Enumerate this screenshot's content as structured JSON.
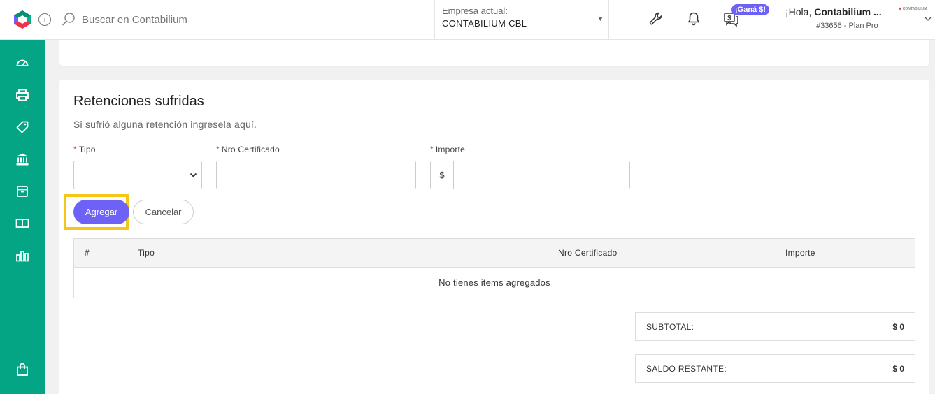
{
  "header": {
    "search_placeholder": "Buscar en Contabilium",
    "company_label": "Empresa actual:",
    "company_name": "CONTABILIUM CBL",
    "promo_badge": "¡Ganá $!",
    "greeting_prefix": "¡Hola, ",
    "greeting_name": "Contabilium ...",
    "plan": "#33656 - Plan Pro",
    "mini_logo": "CONTABILIUM",
    "icons": [
      "wrench-icon",
      "bell-icon",
      "money-chat-icon"
    ]
  },
  "sidebar": {
    "items": [
      {
        "icon": "dashboard-icon"
      },
      {
        "icon": "printer-icon"
      },
      {
        "icon": "tag-icon"
      },
      {
        "icon": "bank-icon"
      },
      {
        "icon": "box-icon"
      },
      {
        "icon": "book-icon"
      },
      {
        "icon": "chart-icon"
      },
      {
        "icon": "shopping-bag-icon"
      }
    ]
  },
  "retenciones": {
    "title": "Retenciones sufridas",
    "subtitle": "Si sufrió alguna retención ingresela aquí.",
    "required_mark": "*",
    "fields": {
      "tipo_label": "Tipo",
      "tipo_value": "",
      "nro_label": "Nro Certificado",
      "nro_value": "",
      "importe_label": "Importe",
      "importe_prefix": "$",
      "importe_value": ""
    },
    "buttons": {
      "add": "Agregar",
      "cancel": "Cancelar"
    },
    "table": {
      "columns": [
        "#",
        "Tipo",
        "Nro Certificado",
        "Importe"
      ],
      "empty_message": "No tienes items agregados"
    },
    "totals": {
      "subtotal_label": "SUBTOTAL:",
      "subtotal_value": "$ 0",
      "saldo_label": "SALDO RESTANTE:",
      "saldo_value": "$ 0"
    }
  },
  "colors": {
    "sidebar": "#03a584",
    "primary": "#6e61f5",
    "highlight": "#f5c617"
  }
}
